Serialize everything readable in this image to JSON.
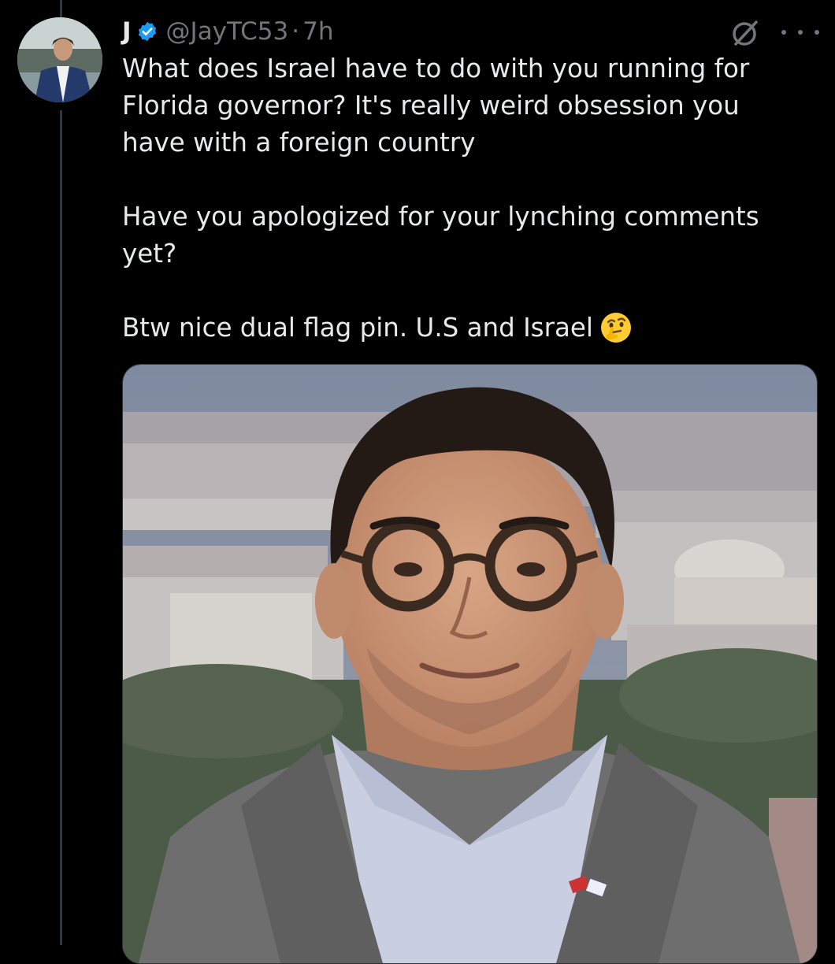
{
  "tweet": {
    "author_name": "J",
    "handle": "@JayTC53",
    "separator": "·",
    "time": "7h",
    "text": "What does Israel have to do with you running for\nFlorida governor? It's really weird obsession you\nhave with a foreign country\n\nHave you apologized for your lynching comments\nyet?\n\nBtw nice dual flag pin. U.S and Israel",
    "emoji": "thinking-face-emoji"
  },
  "icons": {
    "verified": "verified-badge-icon",
    "grok": "grok-icon",
    "more": "more-options-icon"
  },
  "colors": {
    "background": "#000000",
    "text": "#e7e9ea",
    "secondary": "#71767b",
    "verified": "#1d9bf0"
  }
}
